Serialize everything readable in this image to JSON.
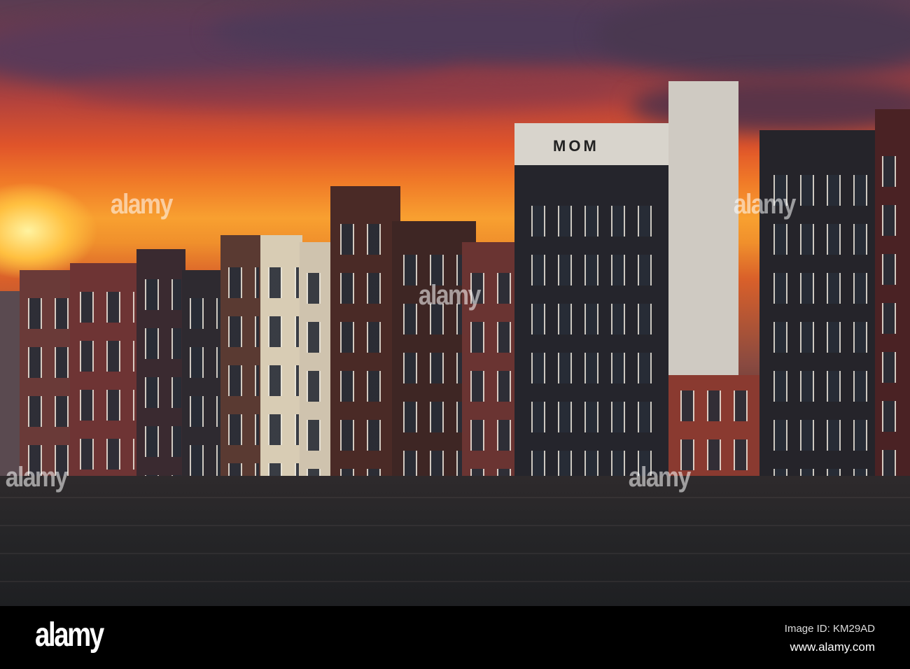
{
  "watermark": {
    "brand": "alamy"
  },
  "footer": {
    "logo": "alamy",
    "image_id": "Image ID: KM29AD",
    "website": "www.alamy.com"
  },
  "facade_sign": "MOM",
  "colors": {
    "sky_orange": "#f07a28",
    "clouds": "#5a3c52",
    "water": "#262628",
    "bar": "#000000"
  }
}
